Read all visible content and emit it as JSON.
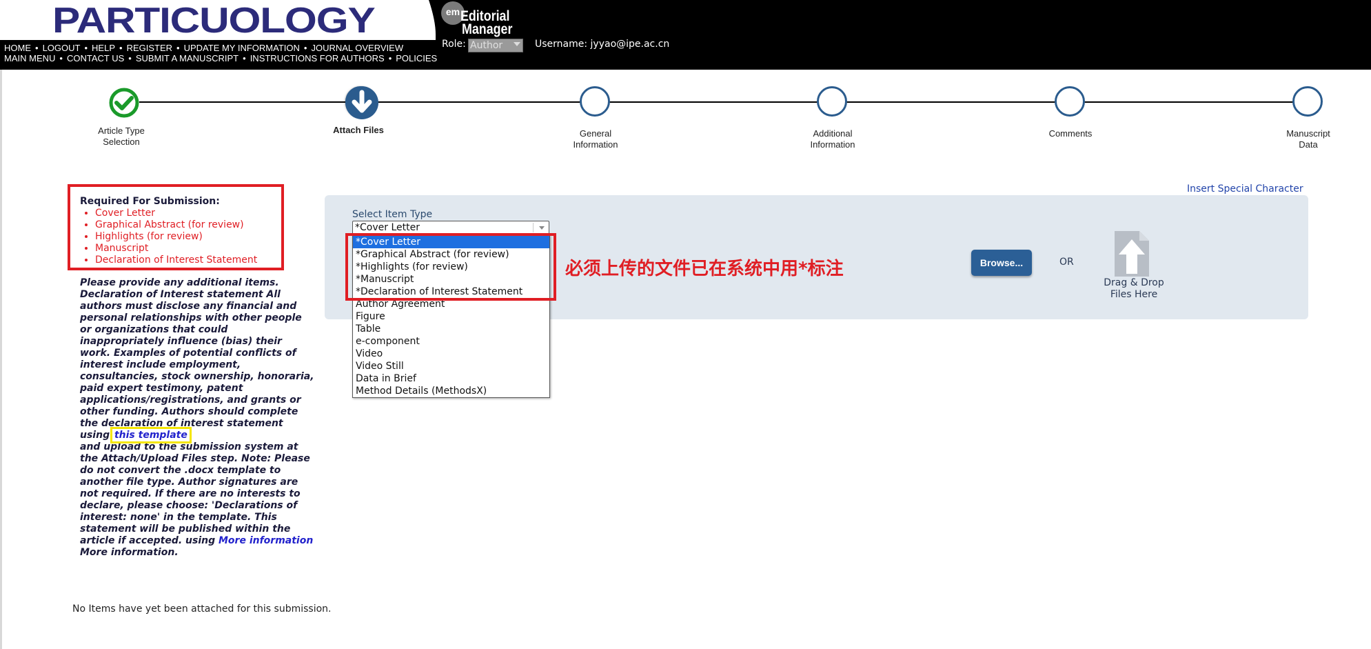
{
  "header": {
    "journal_logo": "PARTICUOLOGY",
    "em_badge": "em",
    "em_line1": "Editorial",
    "em_line2": "Manager",
    "nav_row_1": [
      "HOME",
      "LOGOUT",
      "HELP",
      "REGISTER",
      "UPDATE MY INFORMATION",
      "JOURNAL OVERVIEW"
    ],
    "nav_row_2": [
      "MAIN MENU",
      "CONTACT US",
      "SUBMIT A MANUSCRIPT",
      "INSTRUCTIONS FOR AUTHORS",
      "POLICIES"
    ],
    "nav_separator": "•",
    "role_label": "Role:",
    "role_value": "Author",
    "username": "Username: jyyao@ipe.ac.cn"
  },
  "steps": [
    {
      "label_1": "Article Type",
      "label_2": "Selection",
      "state": "done"
    },
    {
      "label_1": "Attach Files",
      "label_2": "",
      "state": "current"
    },
    {
      "label_1": "General",
      "label_2": "Information",
      "state": "pending"
    },
    {
      "label_1": "Additional",
      "label_2": "Information",
      "state": "pending"
    },
    {
      "label_1": "Comments",
      "label_2": "",
      "state": "pending"
    },
    {
      "label_1": "Manuscript",
      "label_2": "Data",
      "state": "pending"
    }
  ],
  "required": {
    "title": "Required For Submission:",
    "items": [
      "Cover Letter",
      "Graphical Abstract (for review)",
      "Highlights (for review)",
      "Manuscript",
      "Declaration of Interest Statement"
    ]
  },
  "instructions": {
    "part1": "Please provide any additional items. Declaration of Interest statement All authors must disclose any financial and personal relationships with other people or organizations that could inappropriately influence (bias) their work. Examples of potential conflicts of interest include employment, consultancies, stock ownership, honoraria, paid expert testimony, patent applications/registrations, and grants or other funding. Authors should complete the declaration of interest statement using",
    "template_link": "this template",
    "part2": "and upload to the submission system at the Attach/Upload Files step. Note: Please do not convert the .docx template to another file type. Author signatures are not required. If there are no interests to declare, please choose: 'Declarations of interest: none' in the template. This statement will be published within the article if accepted. using",
    "more_link": "More information",
    "part3": "More information."
  },
  "no_items": "No Items have yet been attached for this submission.",
  "upload": {
    "insert_special": "Insert Special Character",
    "select_label": "Select Item Type",
    "selected_value": "*Cover Letter",
    "options": [
      "*Cover Letter",
      "*Graphical Abstract (for review)",
      "*Highlights (for review)",
      "*Manuscript",
      "*Declaration of Interest Statement",
      "Author Agreement",
      "Figure",
      "Table",
      "e-component",
      "Video",
      "Video Still",
      "Data in Brief",
      "Method Details (MethodsX)"
    ],
    "annotation": "必须上传的文件已在系统中用*标注",
    "browse": "Browse...",
    "or": "OR",
    "drop_line1": "Drag & Drop",
    "drop_line2": "Files Here"
  },
  "colors": {
    "header_bg": "#000000",
    "logo_text": "#2c2b7a",
    "accent_blue": "#2b5c8e",
    "success_green": "#1a9a2a",
    "annotation_red": "#e01e24",
    "highlight_yellow": "#f5e600",
    "panel_bg": "#e1e8ef",
    "option_selected": "#1e6fe0"
  }
}
